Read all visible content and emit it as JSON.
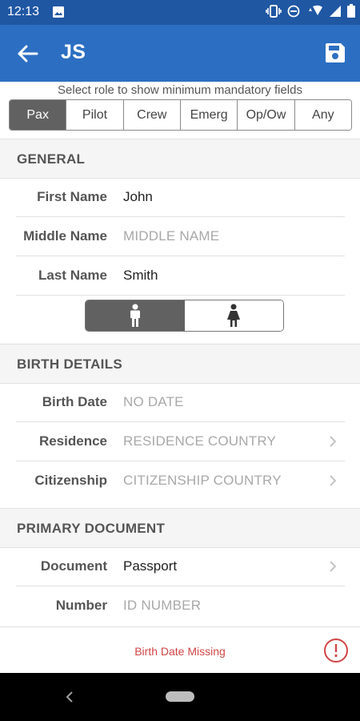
{
  "status_bar": {
    "time": "12:13",
    "icons": [
      "image-icon",
      "vibrate-icon",
      "do-not-disturb-icon",
      "wifi-icon",
      "signal-icon",
      "battery-icon"
    ]
  },
  "app_bar": {
    "title": "JS",
    "icons": {
      "back": "arrow-left-icon",
      "save": "floppy-disk-icon"
    }
  },
  "role_selector": {
    "caption": "Select role to show minimum mandatory fields",
    "options": [
      "Pax",
      "Pilot",
      "Crew",
      "Emerg",
      "Op/Ow",
      "Any"
    ],
    "selected": "Pax"
  },
  "general": {
    "header": "GENERAL",
    "first_name": {
      "label": "First Name",
      "value": "John"
    },
    "middle_name": {
      "label": "Middle Name",
      "placeholder": "MIDDLE NAME"
    },
    "last_name": {
      "label": "Last Name",
      "value": "Smith"
    },
    "gender": {
      "options": [
        "male-icon",
        "female-icon"
      ],
      "selected": "male-icon"
    }
  },
  "birth_details": {
    "header": "BIRTH DETAILS",
    "birth_date": {
      "label": "Birth Date",
      "placeholder": "NO DATE"
    },
    "residence": {
      "label": "Residence",
      "placeholder": "RESIDENCE COUNTRY"
    },
    "citizenship": {
      "label": "Citizenship",
      "placeholder": "CITIZENSHIP COUNTRY"
    }
  },
  "primary_document": {
    "header": "PRIMARY DOCUMENT",
    "document": {
      "label": "Document",
      "value": "Passport"
    },
    "number": {
      "label": "Number",
      "placeholder": "ID NUMBER"
    }
  },
  "footer": {
    "warning": "Birth Date Missing",
    "icon": "info-icon"
  },
  "colors": {
    "status_bar": "#1f57a3",
    "app_bar": "#2c6fc2",
    "segment_active": "#616161",
    "warning": "#d24545"
  }
}
